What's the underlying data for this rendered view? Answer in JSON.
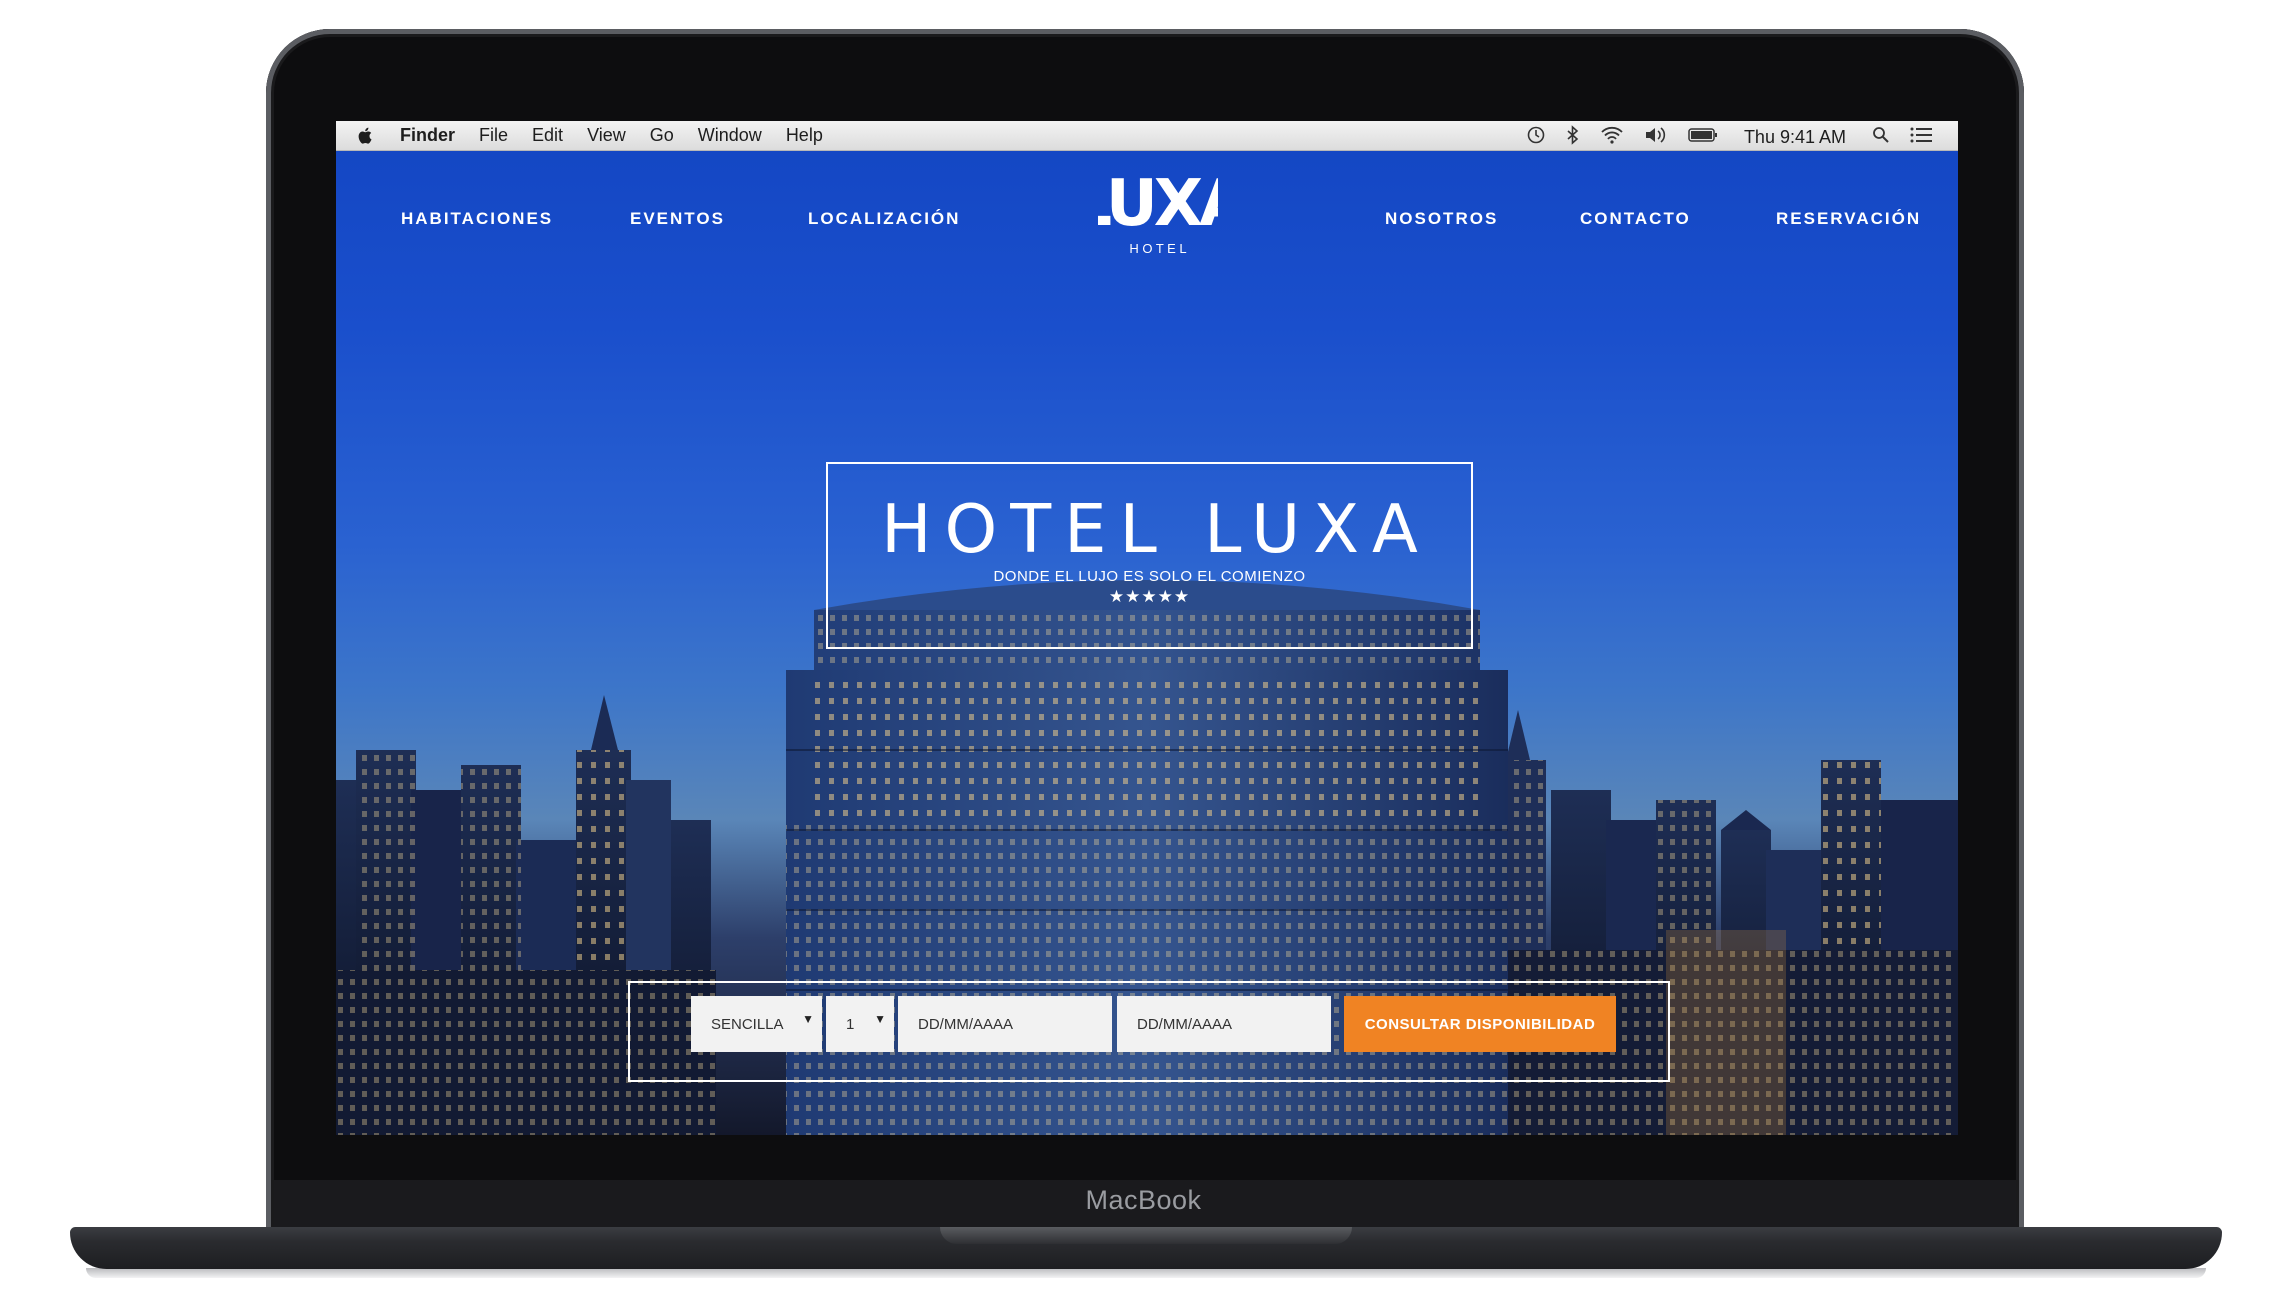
{
  "device": {
    "label": "MacBook"
  },
  "menubar": {
    "apple": "apple-icon",
    "app_name": "Finder",
    "menus": [
      "File",
      "Edit",
      "View",
      "Go",
      "Window",
      "Help"
    ],
    "clock": "Thu 9:41 AM",
    "status_icons": [
      "time-machine-icon",
      "bluetooth-icon",
      "wifi-icon",
      "volume-icon",
      "battery-icon",
      "spotlight-search-icon",
      "notification-center-icon"
    ]
  },
  "site": {
    "nav_left": [
      "HABITACIONES",
      "EVENTOS",
      "LOCALIZACIÓN"
    ],
    "nav_right": [
      "NOSOTROS",
      "CONTACTO",
      "RESERVACIÓN"
    ],
    "logo": {
      "word": "LUXA",
      "sub": "H O T E L"
    },
    "hero": {
      "title": "HOTEL LUXA",
      "subtitle": "DONDE EL LUJO ES SOLO EL COMIENZO",
      "stars": "★★★★★"
    },
    "booking": {
      "room_type": "SENCILLA",
      "guests": "1",
      "checkin_placeholder": "DD/MM/AAAA",
      "checkout_placeholder": "DD/MM/AAAA",
      "submit_label": "CONSULTAR DISPONIBILIDAD"
    }
  },
  "colors": {
    "accent": "#f08323",
    "sky": "#1447c4"
  }
}
